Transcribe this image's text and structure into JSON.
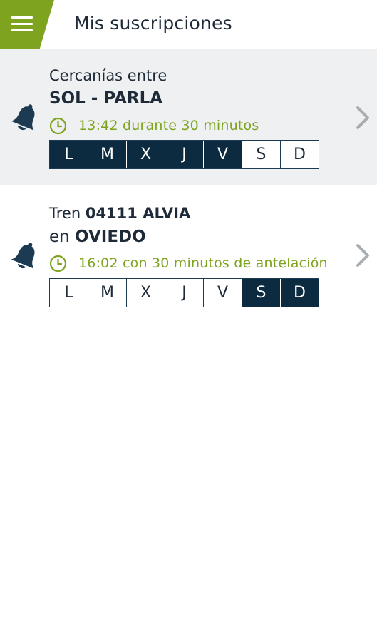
{
  "header": {
    "title": "Mis suscripciones",
    "menu_icon": "hamburger-menu-icon",
    "accent_color": "#7ea31f"
  },
  "subscriptions": [
    {
      "line1_prefix": "Cercanías entre",
      "line1_bold": "",
      "line2_prefix": "",
      "line2_bold": "SOL - PARLA",
      "time_text": "13:42 durante 30 minutos",
      "days": [
        {
          "label": "L",
          "active": true
        },
        {
          "label": "M",
          "active": true
        },
        {
          "label": "X",
          "active": true
        },
        {
          "label": "J",
          "active": true
        },
        {
          "label": "V",
          "active": true
        },
        {
          "label": "S",
          "active": false
        },
        {
          "label": "D",
          "active": false
        }
      ]
    },
    {
      "line1_prefix": "Tren ",
      "line1_bold": "04111 ALVIA",
      "line2_prefix": "en ",
      "line2_bold": "OVIEDO",
      "time_text": "16:02 con 30 minutos de antelación",
      "days": [
        {
          "label": "L",
          "active": false
        },
        {
          "label": "M",
          "active": false
        },
        {
          "label": "X",
          "active": false
        },
        {
          "label": "J",
          "active": false
        },
        {
          "label": "V",
          "active": false
        },
        {
          "label": "S",
          "active": true
        },
        {
          "label": "D",
          "active": true
        }
      ]
    }
  ],
  "colors": {
    "dark_navy": "#0c2a40",
    "time_green": "#7ea31f",
    "card_selected_bg": "#eef0f1"
  }
}
